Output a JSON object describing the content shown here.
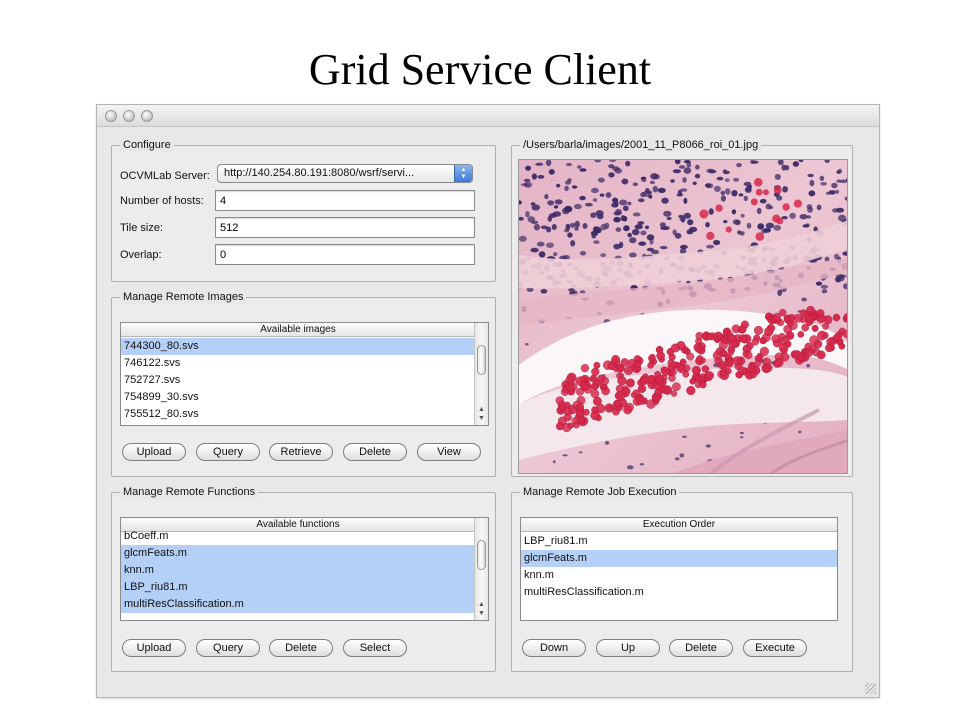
{
  "slide": {
    "title": "Grid Service Client"
  },
  "configure": {
    "title": "Configure",
    "server_label": "OCVMLab Server:",
    "server_value": "http://140.254.80.191:8080/wsrf/servi...",
    "hosts_label": "Number of hosts:",
    "hosts_value": "4",
    "tile_label": "Tile size:",
    "tile_value": "512",
    "overlap_label": "Overlap:",
    "overlap_value": "0"
  },
  "remote_images": {
    "title": "Manage Remote Images",
    "list_header": "Available images",
    "items": [
      "744300_80.svs",
      "746122.svs",
      "752727.svs",
      "754899_30.svs",
      "755512_80.svs"
    ],
    "buttons": {
      "upload": "Upload",
      "query": "Query",
      "retrieve": "Retrieve",
      "delete": "Delete",
      "view": "View"
    }
  },
  "remote_functions": {
    "title": "Manage Remote Functions",
    "list_header": "Available functions",
    "items": [
      "bCoeff.m",
      "glcmFeats.m",
      "knn.m",
      "LBP_riu81.m",
      "multiResClassification.m"
    ],
    "buttons": {
      "upload": "Upload",
      "query": "Query",
      "delete": "Delete",
      "select": "Select"
    }
  },
  "image_view": {
    "path": "/Users/barla/images/2001_11_P8066_roi_01.jpg"
  },
  "job_execution": {
    "title": "Manage Remote Job Execution",
    "list_header": "Execution Order",
    "items": [
      "LBP_riu81.m",
      "glcmFeats.m",
      "knn.m",
      "multiResClassification.m"
    ],
    "buttons": {
      "down": "Down",
      "up": "Up",
      "delete": "Delete",
      "execute": "Execute"
    }
  },
  "colors": {
    "selection": "#b5d0f7",
    "tissue_pink": "#e9b7c6",
    "cell_red": "#d6284a",
    "nucleus_purple": "#3b2a66"
  }
}
